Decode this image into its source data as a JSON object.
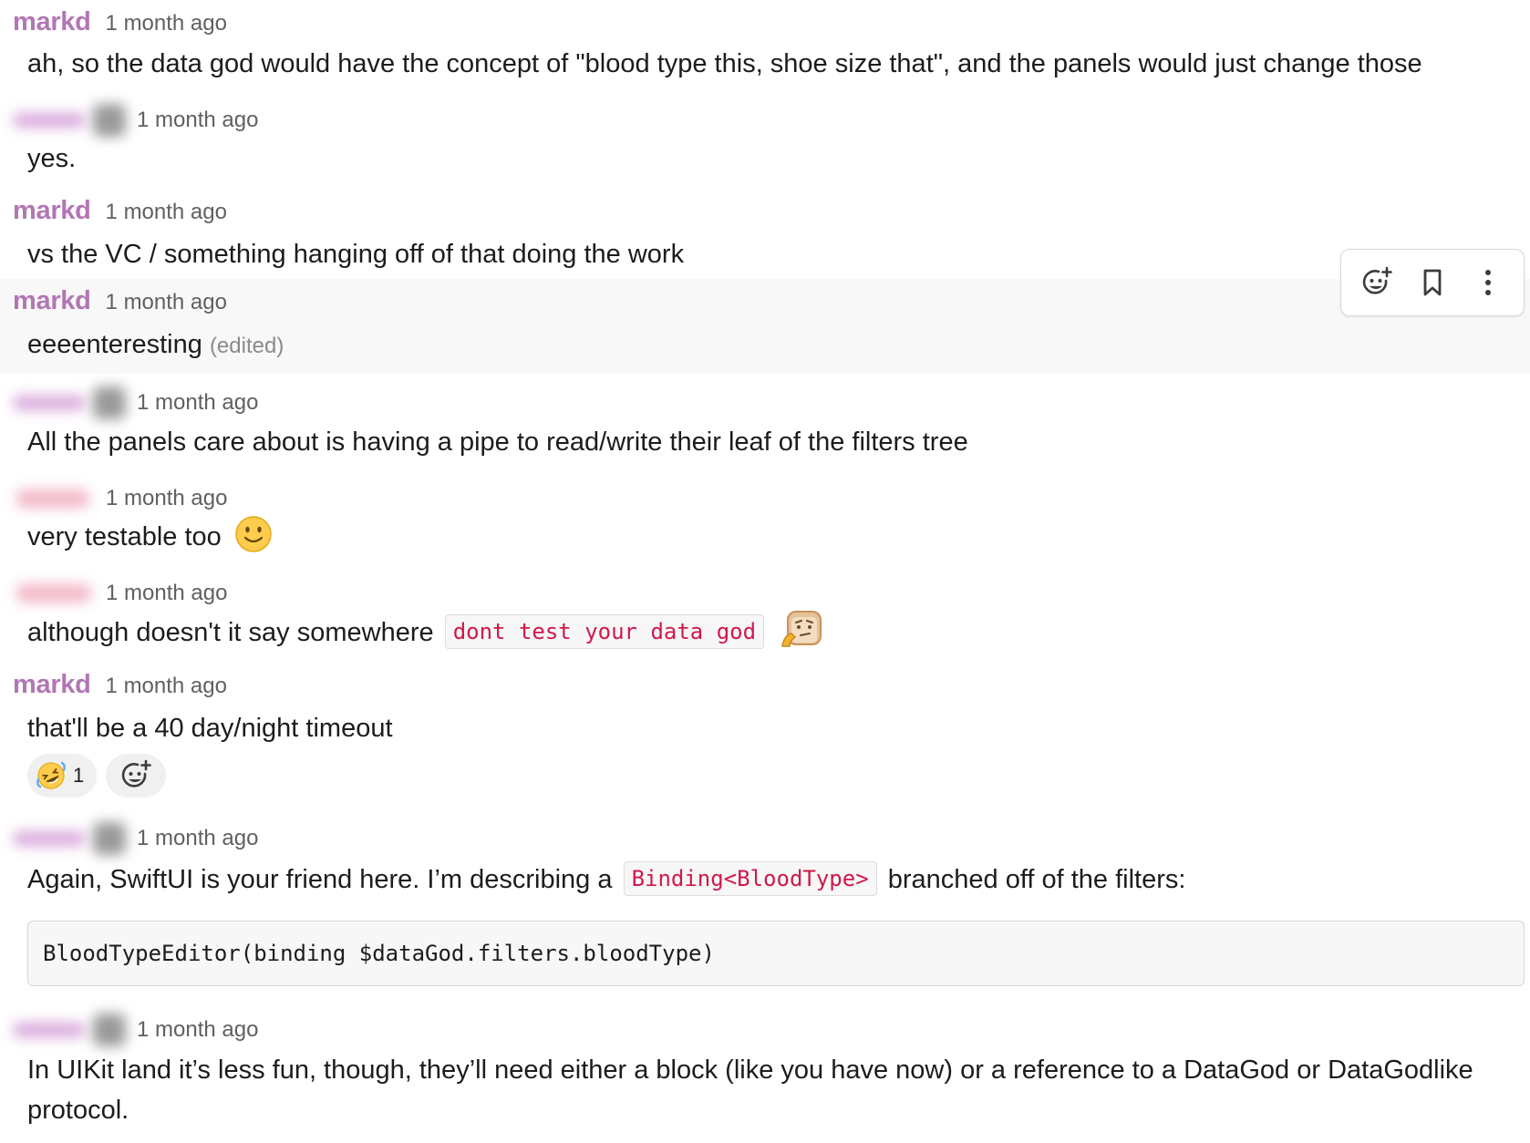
{
  "messages": [
    {
      "author": "markd",
      "time": "1 month ago",
      "text": "ah, so the data god would have the concept of \"blood type this, shoe size that\", and the panels would just change those"
    },
    {
      "author": "",
      "time": "1 month ago",
      "text": "yes."
    },
    {
      "author": "markd",
      "time": "1 month ago",
      "text": "vs the VC / something hanging off of that doing the work"
    },
    {
      "author": "markd",
      "time": "1 month ago",
      "text": "eeeenteresting",
      "edited_label": "(edited)"
    },
    {
      "author": "",
      "time": "1 month ago",
      "text": "All the panels care about is having a pipe to read/write their leaf of the filters tree"
    },
    {
      "author": "",
      "time": "1 month ago",
      "text": "very testable too",
      "emoji": "slightly-smiling-face"
    },
    {
      "author": "",
      "time": "1 month ago",
      "text": "although doesn't it say somewhere",
      "code": "dont test your data god",
      "emoji": "thinking-toast"
    },
    {
      "author": "markd",
      "time": "1 month ago",
      "text": "that'll be a 40 day/night timeout",
      "reactions": [
        {
          "emoji": "rolling-on-floor-laughing",
          "count": "1"
        }
      ]
    },
    {
      "author": "",
      "time": "1 month ago",
      "text_before": "Again, SwiftUI is your friend here. I’m describing a",
      "code": "Binding<BloodType>",
      "text_after": "branched off of the filters:",
      "code_block": "BloodTypeEditor(binding $dataGod.filters.bloodType)"
    },
    {
      "author": "",
      "time": "1 month ago",
      "text": "In UIKit land it’s less fun, though, they’ll need either a block (like you have now) or a reference to a DataGod or DataGodlike protocol."
    }
  ],
  "toolbar": {
    "icons": [
      "add-reaction-icon",
      "bookmark-icon",
      "more-actions-icon"
    ]
  },
  "colors": {
    "author": "#b176b5",
    "code_inline": "#d1184a",
    "hover_bg": "#f8f8f8",
    "timestamp": "#616061"
  }
}
